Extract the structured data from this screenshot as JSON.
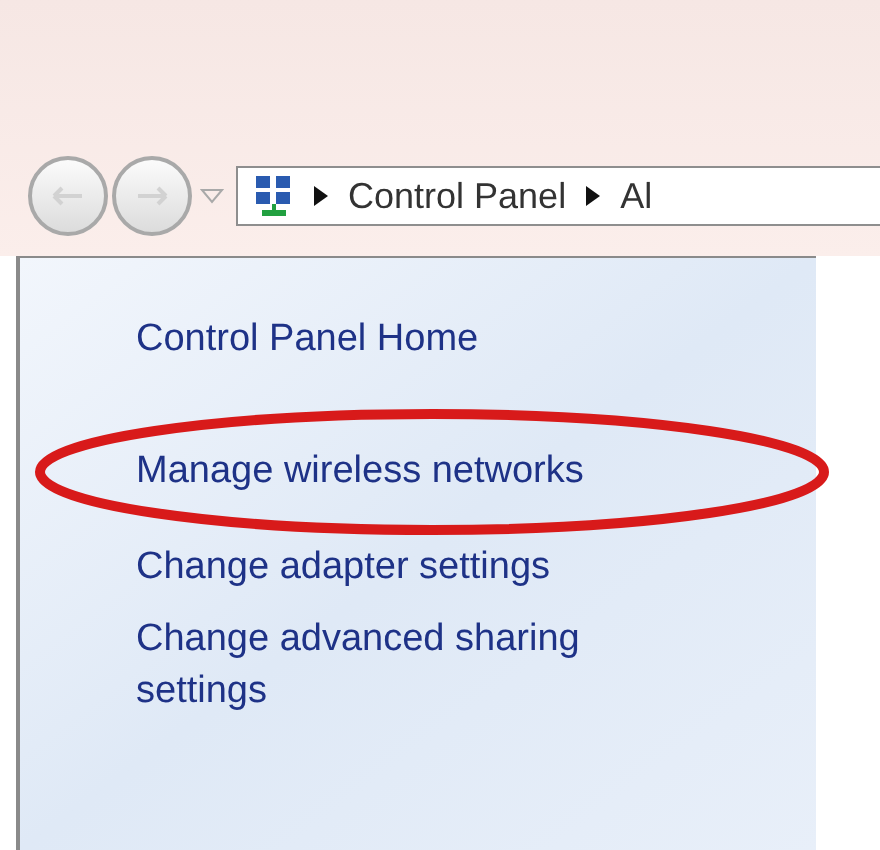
{
  "breadcrumb": [
    "Control Panel",
    "Al"
  ],
  "sidebar": {
    "items": [
      {
        "label": "Control Panel Home",
        "highlighted": false
      },
      {
        "label": "Manage wireless networks",
        "highlighted": true
      },
      {
        "label": "Change adapter settings",
        "highlighted": false
      },
      {
        "label": "Change advanced sharing settings",
        "highlighted": false
      }
    ]
  }
}
